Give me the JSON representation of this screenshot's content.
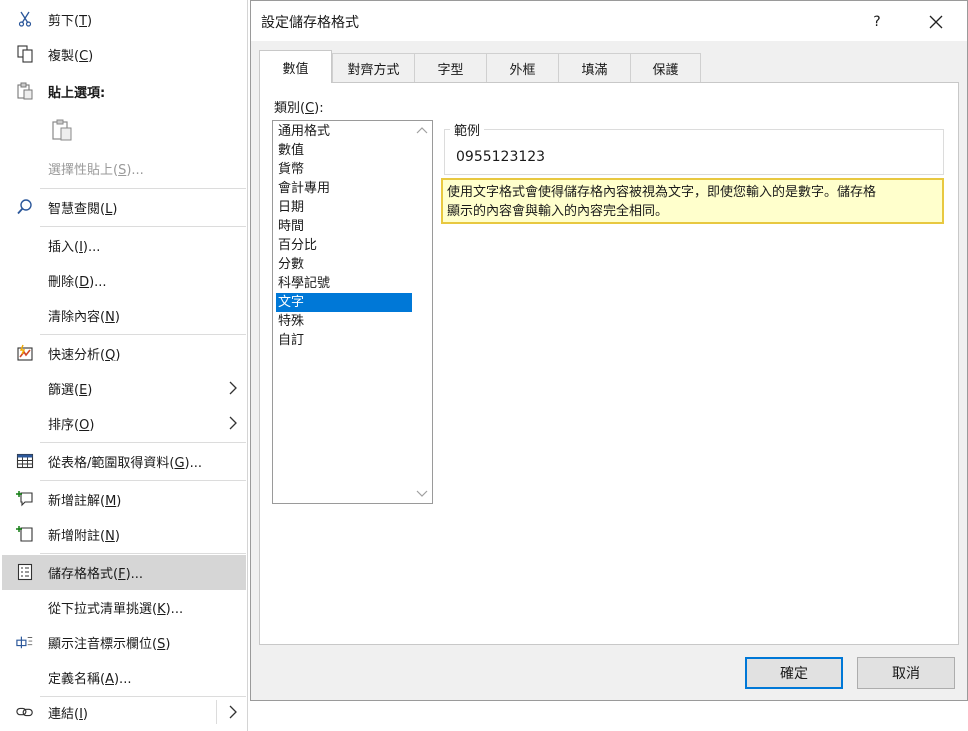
{
  "context_menu": {
    "items": [
      {
        "id": "cut",
        "label": "剪下(",
        "key": "T",
        "tail": ")",
        "icon": "scissors-icon"
      },
      {
        "id": "copy",
        "label": "複製(",
        "key": "C",
        "tail": ")",
        "icon": "copy-icon"
      },
      {
        "id": "paste-options",
        "label": "貼上選項:",
        "key": "",
        "tail": "",
        "icon": "clipboard-icon"
      },
      {
        "id": "paste-special",
        "label": "選擇性貼上(",
        "key": "S",
        "tail": ")...",
        "icon": ""
      },
      {
        "id": "smart-lookup",
        "label": "智慧查閱(",
        "key": "L",
        "tail": ")",
        "icon": "search-icon"
      },
      {
        "id": "insert",
        "label": "插入(",
        "key": "I",
        "tail": ")...",
        "icon": ""
      },
      {
        "id": "delete",
        "label": "刪除(",
        "key": "D",
        "tail": ")...",
        "icon": ""
      },
      {
        "id": "clear-contents",
        "label": "清除內容(",
        "key": "N",
        "tail": ")",
        "icon": ""
      },
      {
        "id": "quick-analysis",
        "label": "快速分析(",
        "key": "Q",
        "tail": ")",
        "icon": "quick-analysis-icon"
      },
      {
        "id": "filter",
        "label": "篩選(",
        "key": "E",
        "tail": ")",
        "icon": ""
      },
      {
        "id": "sort",
        "label": "排序(",
        "key": "O",
        "tail": ")",
        "icon": ""
      },
      {
        "id": "get-data",
        "label": "從表格/範圍取得資料(",
        "key": "G",
        "tail": ")...",
        "icon": "table-icon"
      },
      {
        "id": "new-comment",
        "label": "新增註解(",
        "key": "M",
        "tail": ")",
        "icon": "new-comment-icon"
      },
      {
        "id": "new-note",
        "label": "新增附註(",
        "key": "N",
        "tail": ")",
        "icon": "new-note-icon"
      },
      {
        "id": "format-cells",
        "label": "儲存格格式(",
        "key": "F",
        "tail": ")...",
        "icon": "format-cells-icon"
      },
      {
        "id": "pick-list",
        "label": "從下拉式清單挑選(",
        "key": "K",
        "tail": ")...",
        "icon": ""
      },
      {
        "id": "phonetic",
        "label": "顯示注音標示欄位(",
        "key": "S",
        "tail": ")",
        "icon": "phonetic-icon"
      },
      {
        "id": "define-name",
        "label": "定義名稱(",
        "key": "A",
        "tail": ")...",
        "icon": ""
      },
      {
        "id": "link",
        "label": "連結(",
        "key": "I",
        "tail": ")",
        "icon": "link-icon"
      }
    ]
  },
  "dialog": {
    "title": "設定儲存格格式",
    "help": "?",
    "tabs": [
      "數值",
      "對齊方式",
      "字型",
      "外框",
      "填滿",
      "保護"
    ],
    "category_label_pre": "類別(",
    "category_label_key": "C",
    "category_label_post": "):",
    "categories": [
      "通用格式",
      "數值",
      "貨幣",
      "會計專用",
      "日期",
      "時間",
      "百分比",
      "分數",
      "科學記號",
      "文字",
      "特殊",
      "自訂"
    ],
    "selected_category": "文字",
    "sample_legend": "範例",
    "sample_value": "0955123123",
    "note_line1": "使用文字格式會使得儲存格內容被視為文字，即使您輸入的是數字。儲存格",
    "note_line2": "顯示的內容會與輸入的內容完全相同。",
    "ok_label": "確定",
    "cancel_label": "取消"
  },
  "colors": {
    "selection": "#0078d7",
    "note_bg": "#ffffcc",
    "note_border": "#e8c840",
    "menu_highlight": "#d6d6d6"
  }
}
